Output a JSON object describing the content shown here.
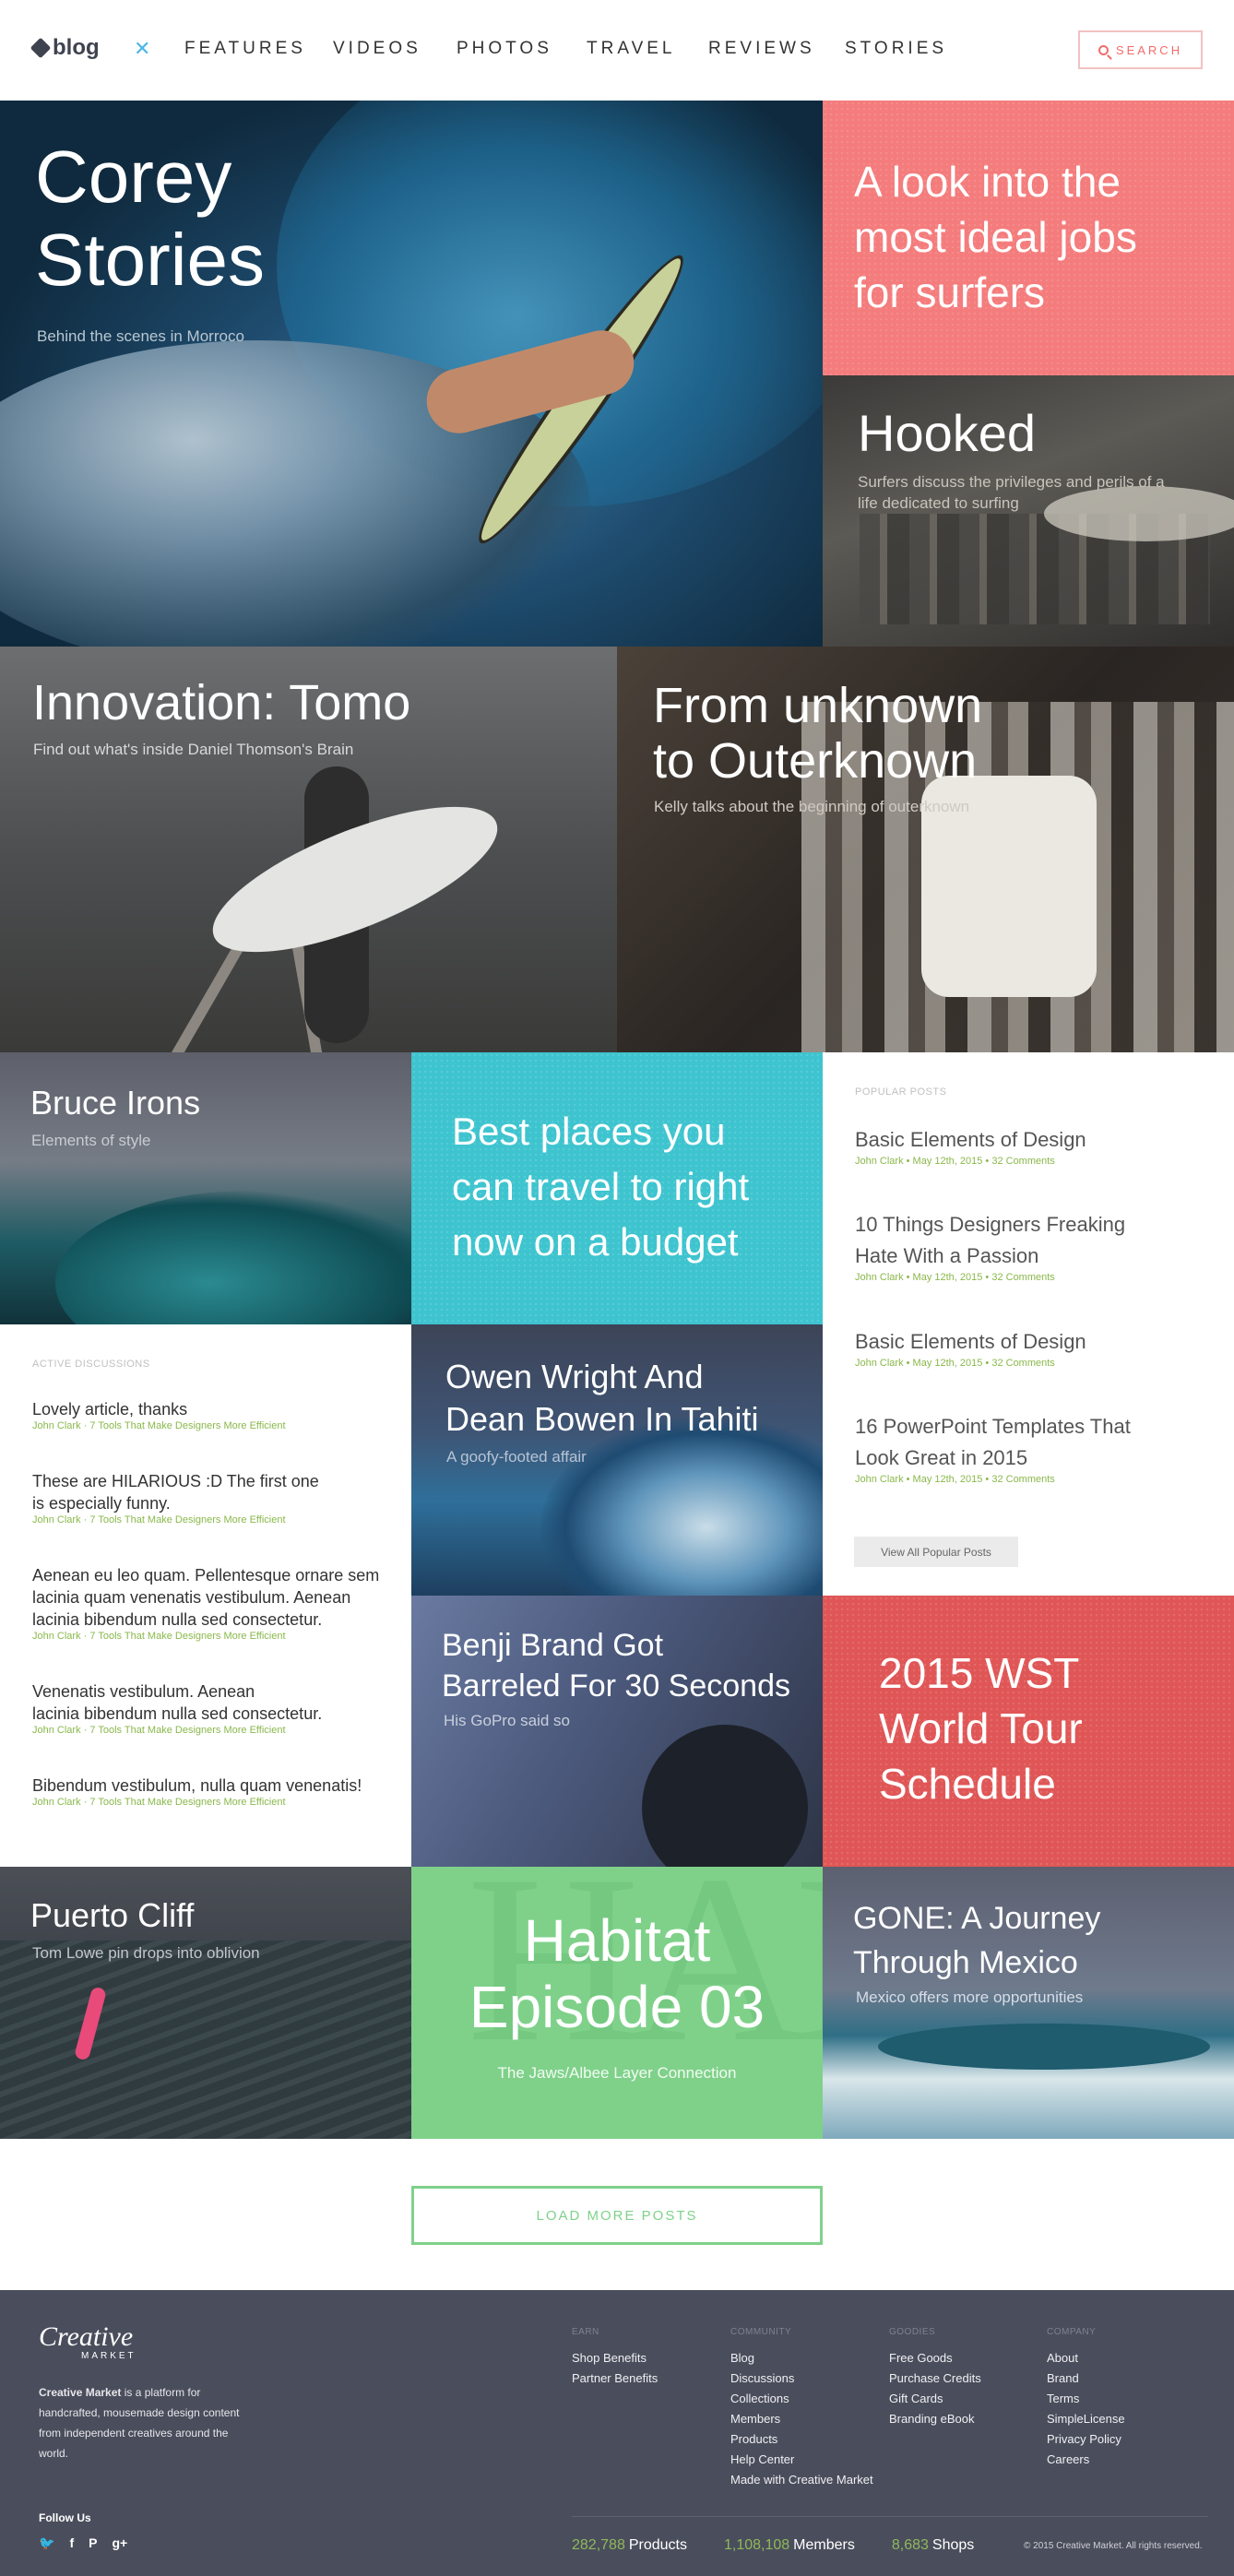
{
  "header": {
    "logo_text": "blog",
    "nav": [
      "FEATURES",
      "VIDEOS",
      "PHOTOS",
      "TRAVEL",
      "REVIEWS",
      "STORIES"
    ],
    "search_label": "SEARCH"
  },
  "tiles": {
    "corey": {
      "title_line1": "Corey",
      "title_line2": "Stories",
      "subtitle": "Behind the scenes in Morroco"
    },
    "ideal": {
      "title_line1": "A look into the",
      "title_line2": "most ideal jobs",
      "title_line3": "for surfers"
    },
    "hooked": {
      "title": "Hooked",
      "subtitle_line1": "Surfers discuss the privileges and perils of a",
      "subtitle_line2": "life dedicated to surfing"
    },
    "tomo": {
      "title": "Innovation: Tomo",
      "subtitle": "Find out what's inside Daniel Thomson's Brain"
    },
    "outer": {
      "title_line1": "From unknown",
      "title_line2": "to Outerknown",
      "subtitle": "Kelly talks about the beginning of outerknown"
    },
    "bruce": {
      "title": "Bruce Irons",
      "subtitle": "Elements of style"
    },
    "best": {
      "title_line1": "Best places you",
      "title_line2": "can travel to right",
      "title_line3": "now on a budget"
    },
    "owen": {
      "title_line1": "Owen Wright And",
      "title_line2": "Dean Bowen In Tahiti",
      "subtitle": "A goofy-footed affair"
    },
    "benji": {
      "title_line1": "Benji Brand Got",
      "title_line2": "Barreled For 30 Seconds",
      "subtitle": "His GoPro said so"
    },
    "wst": {
      "title_line1": "2015 WST",
      "title_line2": "World Tour",
      "title_line3": "Schedule"
    },
    "cliff": {
      "title": "Puerto Cliff",
      "subtitle": "Tom Lowe pin drops into oblivion"
    },
    "habitat": {
      "title_line1": "Habitat",
      "title_line2": "Episode 03",
      "subtitle": "The Jaws/Albee Layer Connection",
      "ghost": "HAB"
    },
    "gone": {
      "title_line1": "GONE: A Journey",
      "title_line2": "Through Mexico",
      "subtitle": "Mexico offers more opportunities"
    }
  },
  "popular": {
    "heading": "POPULAR POSTS",
    "posts": [
      {
        "line1": "Basic Elements of Design",
        "line2": "",
        "meta": "John Clark • May 12th, 2015 • 32 Comments"
      },
      {
        "line1": "10 Things Designers Freaking",
        "line2": "Hate With a Passion",
        "meta": "John Clark • May 12th, 2015 • 32 Comments"
      },
      {
        "line1": "Basic Elements of Design",
        "line2": "",
        "meta": "John Clark • May 12th, 2015 • 32 Comments"
      },
      {
        "line1": "16 PowerPoint Templates That",
        "line2": "Look Great in 2015",
        "meta": "John Clark • May 12th, 2015 • 32 Comments"
      }
    ],
    "view_all": "View All Popular Posts"
  },
  "discussions": {
    "heading": "ACTIVE DISCUSSIONS",
    "items": [
      {
        "lines": [
          "Lovely article, thanks"
        ],
        "meta": "John Clark · 7 Tools That Make Designers More Efficient"
      },
      {
        "lines": [
          "These are HILARIOUS :D The first one",
          "is especially funny."
        ],
        "meta": "John Clark · 7 Tools That Make Designers More Efficient"
      },
      {
        "lines": [
          "Aenean eu leo quam. Pellentesque ornare sem",
          "lacinia quam venenatis vestibulum. Aenean",
          "lacinia bibendum nulla sed consectetur."
        ],
        "meta": "John Clark · 7 Tools That Make Designers More Efficient"
      },
      {
        "lines": [
          "Venenatis vestibulum. Aenean",
          "lacinia bibendum nulla sed consectetur."
        ],
        "meta": "John Clark · 7 Tools That Make Designers More Efficient"
      },
      {
        "lines": [
          "Bibendum vestibulum, nulla quam venenatis!"
        ],
        "meta": "John Clark · 7 Tools That Make Designers More Efficient"
      }
    ]
  },
  "load_more": "LOAD MORE POSTS",
  "footer": {
    "logo": "Creative",
    "logo_sub": "MARKET",
    "desc_bold": "Creative Market",
    "desc_rest": " is a platform for handcrafted, mousemade design content from independent creatives around the world.",
    "follow": "Follow Us",
    "columns": [
      {
        "head": "EARN",
        "links": [
          "Shop Benefits",
          "Partner Benefits"
        ]
      },
      {
        "head": "COMMUNITY",
        "links": [
          "Blog",
          "Discussions",
          "Collections",
          "Members",
          "Products",
          "Help Center",
          "Made with Creative Market"
        ]
      },
      {
        "head": "GOODIES",
        "links": [
          "Free Goods",
          "Purchase Credits",
          "Gift Cards",
          "Branding eBook"
        ]
      },
      {
        "head": "COMPANY",
        "links": [
          "About",
          "Brand",
          "Terms",
          "SimpleLicense",
          "Privacy Policy",
          "Careers"
        ]
      }
    ],
    "stats": [
      {
        "num": "282,788",
        "label": "Products"
      },
      {
        "num": "1,108,108",
        "label": "Members"
      },
      {
        "num": "8,683",
        "label": "Shops"
      }
    ],
    "copyright": "© 2015 Creative Market. All rights reserved."
  },
  "colors": {
    "coral": "#f47c7c",
    "teal": "#3ec4cf",
    "red": "#e05656",
    "green": "#7fd18a",
    "footer": "#4a4e5c",
    "meta_green": "#8ab84b"
  }
}
